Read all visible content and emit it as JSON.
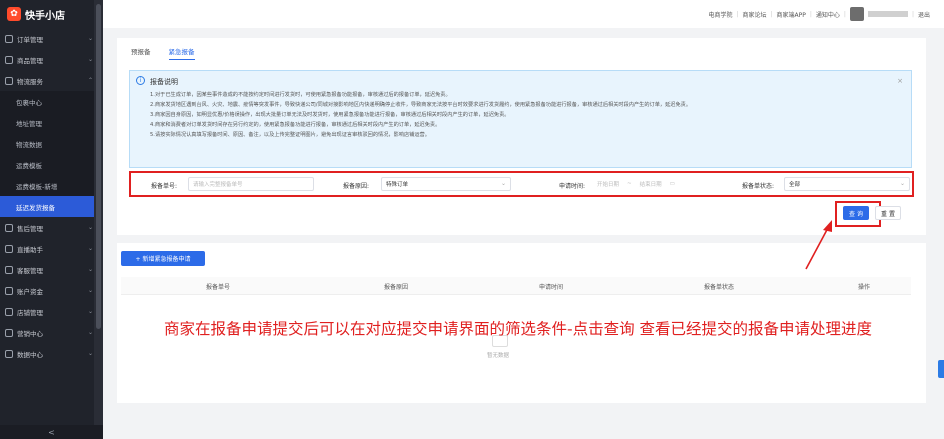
{
  "app": {
    "name": "快手小店"
  },
  "sidebar": {
    "items": [
      {
        "label": "订单管理",
        "caret": "⌄"
      },
      {
        "label": "商品管理",
        "caret": "⌄"
      },
      {
        "label": "物流服务",
        "caret": "⌃"
      },
      {
        "label": "售后管理",
        "caret": "⌄"
      },
      {
        "label": "直播助手",
        "caret": "⌄"
      },
      {
        "label": "客服管理",
        "caret": "⌄"
      },
      {
        "label": "账户资金",
        "caret": "⌄"
      },
      {
        "label": "店铺管理",
        "caret": "⌄"
      },
      {
        "label": "营销中心",
        "caret": "⌄"
      },
      {
        "label": "数据中心",
        "caret": "⌄"
      }
    ],
    "sub_items": [
      "包裹中心",
      "地址管理",
      "物流数据",
      "运费模板",
      "运费模板-新增",
      "延迟发货报备"
    ],
    "collapse_label": "<"
  },
  "header": {
    "links": [
      "电商学院",
      "商家论坛",
      "商家端APP",
      "通知中心"
    ],
    "logout": "退出"
  },
  "tabs": [
    "预报备",
    "紧急报备"
  ],
  "notice": {
    "title": "报备说明",
    "close": "×",
    "lines": [
      "1.对于已生成订单，因某些事件造成的不能按约定时间进行发货时，可使用紧急报备功能报备，审核通过后的报备订单，延迟免责。",
      "2.商家发货地区遇到台风、火灾、地震、疫情等突发事件，导致快递公司/同城对接影响地区内快递明确停止收件，导致商家无法按平台时效要求进行发货履约，使用紧急报备功能进行报备，审核通过后相关时段内产生的订单，延迟免责。",
      "3.商家因自身原因，如明显优惠/价格误操作，出现大批量订单无法及时发货时，使用紧急报备功能进行报备，审核通过后相关时段内产生的订单，延迟免责。",
      "4.商家和消费者对订单发货时间存在另行约定的，使用紧急报备功能进行报备，审核通过后相关时段内产生的订单，延迟免责。",
      "5.请按实际情况认真填写报备时间、原因、备注，以及上传完整证明图片，避免出现证言审核驳回的情况，影响店铺运营。"
    ]
  },
  "filter": {
    "order_label": "报备单号:",
    "order_placeholder": "请输入完整报备单号",
    "reason_label": "报备原因:",
    "reason_value": "特殊订单",
    "time_label": "申请时间:",
    "start_placeholder": "开始日期",
    "range_sep": "~",
    "end_placeholder": "结束日期",
    "status_label": "报备单状态:",
    "status_value": "全部"
  },
  "buttons": {
    "query": "查 询",
    "reset": "重 置",
    "add": "+ 新增紧急报备申请"
  },
  "table": {
    "columns": [
      "报备单号",
      "报备原因",
      "申请时间",
      "报备单状态",
      "操作"
    ],
    "empty_text": "暂无数据"
  },
  "annotation": "商家在报备申请提交后可以在对应提交申请界面的筛选条件-点击查询 查看已经提交的报备申请处理进度",
  "colors": {
    "accent": "#2c6be8",
    "highlight": "#e02020",
    "sidebar": "#20232b"
  }
}
